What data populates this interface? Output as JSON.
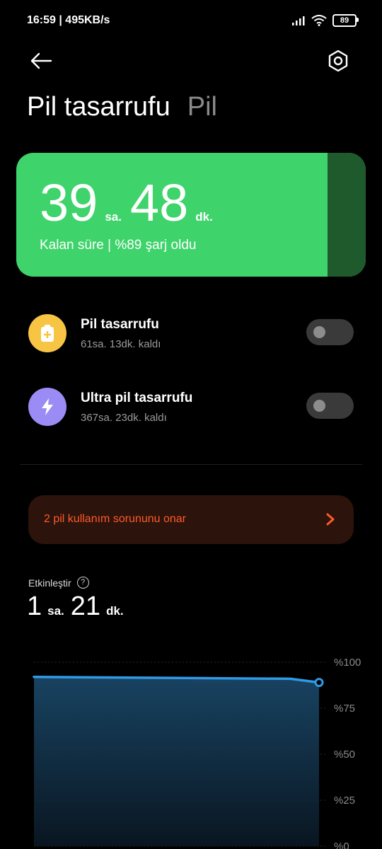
{
  "status_bar": {
    "time": "16:59 | 495KB/s",
    "battery_level": "89"
  },
  "header": {
    "title": "Pil tasarrufu",
    "tab": "Pil"
  },
  "battery_card": {
    "hours": "39",
    "hours_unit": "sa.",
    "minutes": "48",
    "minutes_unit": "dk.",
    "subtitle": "Kalan süre | %89 şarj oldu",
    "charge_fraction": 0.89,
    "color_fill": "#3ed36b",
    "color_empty": "#1f5a2d"
  },
  "modes": [
    {
      "title": "Pil tasarrufu",
      "subtitle": "61sa. 13dk. kaldı",
      "icon": "battery-plus-icon",
      "icon_color": "#f7c443",
      "enabled": false
    },
    {
      "title": "Ultra pil tasarrufu",
      "subtitle": "367sa. 23dk. kaldı",
      "icon": "lightning-icon",
      "icon_color": "#9b8cf5",
      "enabled": false
    }
  ],
  "issue_banner": {
    "text": "2 pil kullanım sorununu onar",
    "color": "#ff5a2a"
  },
  "activity": {
    "label": "Etkinleştir",
    "hours": "1",
    "hours_unit": "sa.",
    "minutes": "21",
    "minutes_unit": "dk."
  },
  "chart_data": {
    "type": "area",
    "y_ticks": [
      "%100",
      "%75",
      "%50",
      "%25",
      "%0"
    ],
    "ylim": [
      0,
      100
    ],
    "x": [
      0,
      0.9,
      1
    ],
    "values": [
      92,
      91,
      89
    ],
    "line_color": "#2f9be6",
    "grid": true
  }
}
